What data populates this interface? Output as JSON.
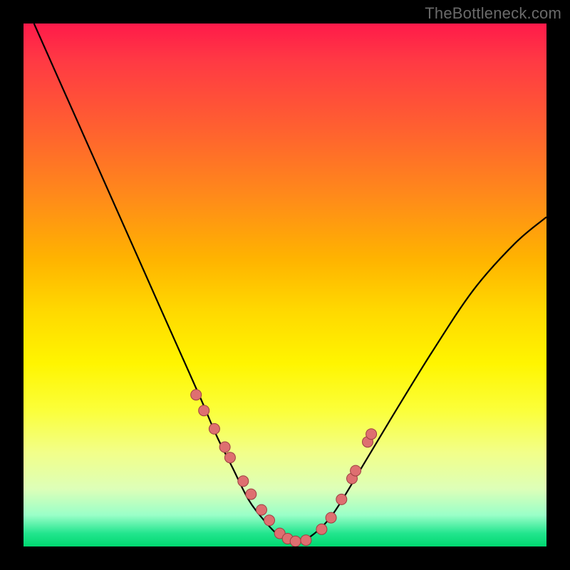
{
  "watermark": "TheBottleneck.com",
  "chart_data": {
    "type": "line",
    "title": "",
    "xlabel": "",
    "ylabel": "",
    "xlim": [
      0,
      1
    ],
    "ylim": [
      0,
      1
    ],
    "series": [
      {
        "name": "bottleneck-curve",
        "x": [
          0.02,
          0.06,
          0.1,
          0.14,
          0.18,
          0.22,
          0.26,
          0.3,
          0.34,
          0.37,
          0.4,
          0.43,
          0.46,
          0.49,
          0.52,
          0.55,
          0.59,
          0.64,
          0.7,
          0.78,
          0.86,
          0.94,
          1.0
        ],
        "y": [
          1.0,
          0.91,
          0.82,
          0.73,
          0.64,
          0.55,
          0.46,
          0.37,
          0.28,
          0.21,
          0.15,
          0.09,
          0.05,
          0.02,
          0.01,
          0.02,
          0.06,
          0.14,
          0.24,
          0.37,
          0.49,
          0.58,
          0.63
        ]
      }
    ],
    "markers": {
      "name": "highlight-dots",
      "x": [
        0.33,
        0.345,
        0.365,
        0.385,
        0.395,
        0.42,
        0.435,
        0.455,
        0.47,
        0.49,
        0.505,
        0.52,
        0.54,
        0.57,
        0.588,
        0.608,
        0.628,
        0.635,
        0.658,
        0.665
      ],
      "y": [
        0.29,
        0.26,
        0.225,
        0.19,
        0.17,
        0.125,
        0.1,
        0.07,
        0.05,
        0.025,
        0.015,
        0.01,
        0.012,
        0.033,
        0.055,
        0.09,
        0.13,
        0.145,
        0.2,
        0.215
      ]
    },
    "colors": {
      "curve": "#000000",
      "marker_fill": "#de6f70",
      "marker_stroke": "#9c3f41"
    }
  }
}
